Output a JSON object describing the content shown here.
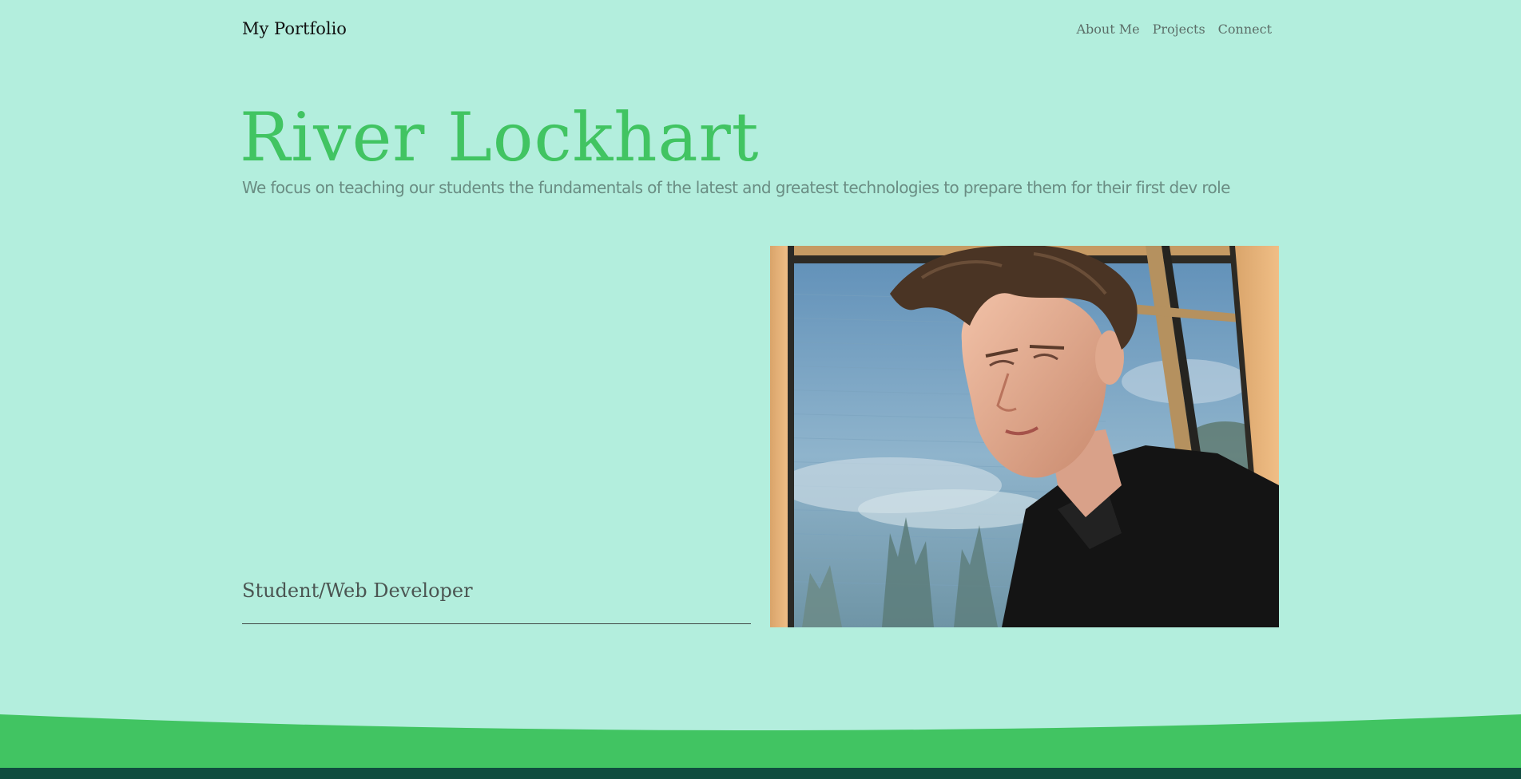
{
  "nav": {
    "brand": "My Portfolio",
    "links": [
      {
        "label": "About Me"
      },
      {
        "label": "Projects"
      },
      {
        "label": "Connect"
      }
    ]
  },
  "hero": {
    "title": "River Lockhart",
    "subtitle": "We focus on teaching our students the fundamentals of the latest and greatest technologies to prepare them for their first dev role"
  },
  "profile": {
    "role": "Student/Web Developer"
  },
  "colors": {
    "background": "#b3eedd",
    "accent": "#41c462",
    "footer": "#0f4d3f"
  }
}
